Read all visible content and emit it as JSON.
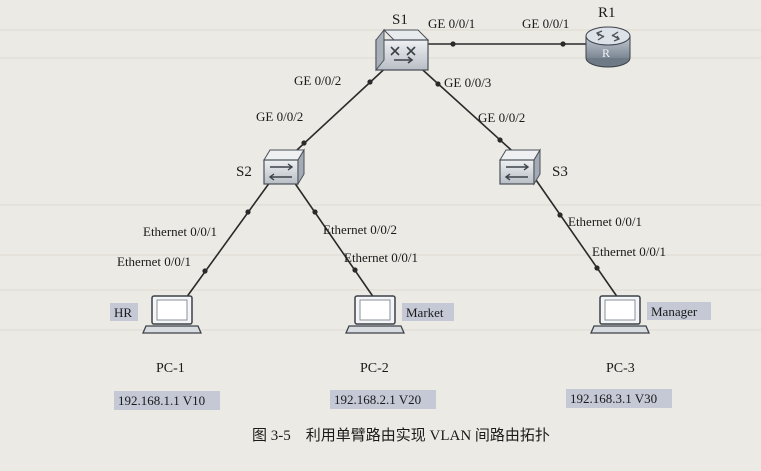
{
  "diagram": {
    "devices": {
      "s1": {
        "label": "S1",
        "kind": "core-switch"
      },
      "r1": {
        "label": "R1",
        "kind": "router"
      },
      "s2": {
        "label": "S2",
        "kind": "switch"
      },
      "s3": {
        "label": "S3",
        "kind": "switch"
      },
      "pc1": {
        "label": "PC-1",
        "tag": "HR",
        "ip": "192.168.1.1 V10"
      },
      "pc2": {
        "label": "PC-2",
        "tag": "Market",
        "ip": "192.168.2.1 V20"
      },
      "pc3": {
        "label": "PC-3",
        "tag": "Manager",
        "ip": "192.168.3.1 V30"
      }
    },
    "links": {
      "s1_r1": {
        "a_port": "GE 0/0/1",
        "b_port": "GE 0/0/1"
      },
      "s1_s2": {
        "a_port": "GE 0/0/2",
        "b_port": "GE 0/0/2"
      },
      "s1_s3": {
        "a_port": "GE 0/0/3",
        "b_port": "GE 0/0/2"
      },
      "s2_pc1": {
        "a_port": "Ethernet 0/0/1",
        "b_port": "Ethernet 0/0/1"
      },
      "s2_pc2": {
        "a_port": "Ethernet 0/0/2",
        "b_port": "Ethernet 0/0/1"
      },
      "s3_pc3": {
        "a_port": "Ethernet 0/0/1",
        "b_port": "Ethernet 0/0/1"
      }
    },
    "caption": "图 3-5　利用单臂路由实现 VLAN 间路由拓扑",
    "colors": {
      "background": "#eceae4",
      "line": "#2a2a2a",
      "ip_box": "#c5c9d6",
      "tag_box": "#c5c9d6",
      "router": "#8f9aa7",
      "switch_face": "#d0d4da",
      "switch_top": "#e6e9ec"
    }
  }
}
